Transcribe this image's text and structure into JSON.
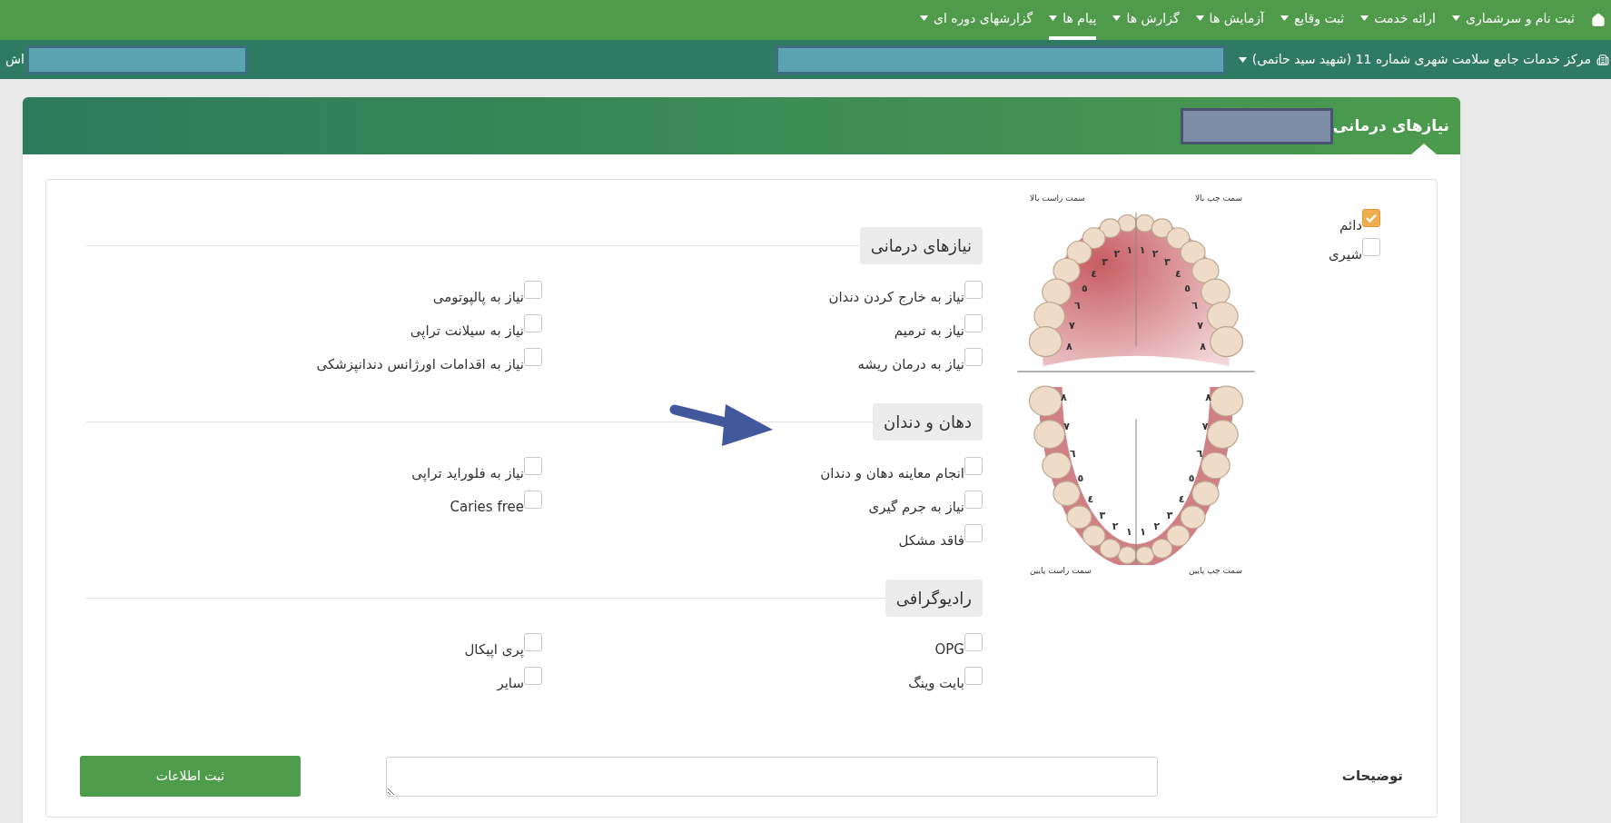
{
  "nav": {
    "items": [
      {
        "label": "ثبت نام و سرشماری",
        "selected": false
      },
      {
        "label": "ارائه خدمت",
        "selected": false
      },
      {
        "label": "ثبت وقایع",
        "selected": false
      },
      {
        "label": "آزمایش ها",
        "selected": false
      },
      {
        "label": "گزارش ها",
        "selected": false
      },
      {
        "label": "پیام ها",
        "selected": true
      },
      {
        "label": "گزارشهای دوره ای",
        "selected": false
      }
    ]
  },
  "center_bar": {
    "center": "مرکز خدمات جامع سلامت شهری شماره 11 (شهید سید حاتمی)",
    "user_suffix": "اش"
  },
  "panel": {
    "title": "نیازهای درمانی"
  },
  "dentition": [
    {
      "label": "دائم",
      "checked": true
    },
    {
      "label": "شیری",
      "checked": false
    }
  ],
  "chart": {
    "quadrants": [
      {
        "label": "سمت چپ بالا",
        "tooth_numbers": [
          "۱",
          "۲",
          "۳",
          "٤",
          "٥",
          "٦",
          "۷",
          "۸"
        ]
      },
      {
        "label": "سمت راست بالا",
        "tooth_numbers": [
          "۱",
          "۲",
          "۳",
          "٤",
          "٥",
          "٦",
          "۷",
          "۸"
        ]
      },
      {
        "label": "سمت چپ پایین",
        "tooth_numbers": [
          "۱",
          "۲",
          "۳",
          "٤",
          "٥",
          "٦",
          "۷",
          "۸"
        ]
      },
      {
        "label": "سمت راست پایین",
        "tooth_numbers": [
          "۱",
          "۲",
          "۳",
          "٤",
          "٥",
          "٦",
          "۷",
          "۸"
        ]
      }
    ]
  },
  "sections": [
    {
      "title": "نیازهای درمانی",
      "columns": [
        {
          "options": [
            {
              "label": "نیاز به خارج کردن دندان",
              "checked": false
            },
            {
              "label": "نیاز به ترمیم",
              "checked": false
            },
            {
              "label": "نیاز به درمان ریشه",
              "checked": false
            }
          ]
        },
        {
          "options": [
            {
              "label": "نیاز به پالپوتومی",
              "checked": false
            },
            {
              "label": "نیاز به سیلانت تراپی",
              "checked": false
            },
            {
              "label": "نیاز به اقدامات اورژانس دندانپزشکی",
              "checked": false
            }
          ]
        }
      ]
    },
    {
      "title": "دهان و دندان",
      "columns": [
        {
          "options": [
            {
              "label": "انجام معاینه دهان و دندان",
              "checked": false
            },
            {
              "label": "نیاز به جرم گیری",
              "checked": false
            },
            {
              "label": "فاقد مشکل",
              "checked": false
            }
          ]
        },
        {
          "options": [
            {
              "label": "نیاز به فلوراید تراپی",
              "checked": false
            },
            {
              "label": "Caries free",
              "checked": false
            }
          ]
        }
      ]
    },
    {
      "title": "رادیوگرافی",
      "columns": [
        {
          "options": [
            {
              "label": "OPG",
              "checked": false
            },
            {
              "label": "بایت وینگ",
              "checked": false
            }
          ]
        },
        {
          "options": [
            {
              "label": "پری اپیکال",
              "checked": false
            },
            {
              "label": "سایر",
              "checked": false
            }
          ]
        }
      ]
    }
  ],
  "notes": {
    "label": "توضیحات"
  },
  "submit": {
    "label": "ثبت اطلاعات"
  }
}
